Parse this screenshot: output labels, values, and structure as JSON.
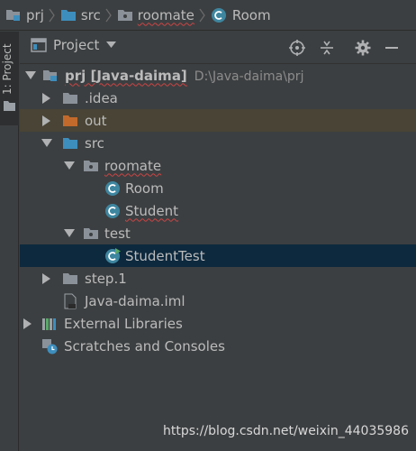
{
  "breadcrumb": {
    "items": [
      {
        "label": "prj",
        "icon": "module-folder-icon"
      },
      {
        "label": "src",
        "icon": "folder-icon"
      },
      {
        "label": "roomate",
        "icon": "package-icon"
      },
      {
        "label": "Room",
        "icon": "class-icon"
      }
    ]
  },
  "tool_strip": {
    "project_tab_label": "1: Project"
  },
  "panel": {
    "title": "Project",
    "actions": [
      "locate-icon",
      "collapse-all-icon",
      "gear-icon",
      "minimize-icon"
    ]
  },
  "tree": {
    "root": {
      "label": "prj [Java-daima]",
      "path": "D:\\Java-daima\\prj"
    },
    "idea": {
      "label": ".idea"
    },
    "out": {
      "label": "out"
    },
    "src": {
      "label": "src"
    },
    "roomate": {
      "label": "roomate"
    },
    "room": {
      "label": "Room"
    },
    "student": {
      "label": "Student"
    },
    "test": {
      "label": "test"
    },
    "studenttest": {
      "label": "StudentTest"
    },
    "step1": {
      "label": "step.1"
    },
    "iml": {
      "label": "Java-daima.iml"
    },
    "external": {
      "label": "External Libraries"
    },
    "scratches": {
      "label": "Scratches and Consoles"
    }
  },
  "watermark": "https://blog.csdn.net/weixin_44035986",
  "colors": {
    "background": "#3c3f41",
    "selection": "#0d293e",
    "excluded_highlight": "#494435",
    "folder_blue": "#3d8ebd",
    "folder_orange": "#c26a2c",
    "class_teal": "#3e86a0",
    "text": "#bbbbbb"
  }
}
